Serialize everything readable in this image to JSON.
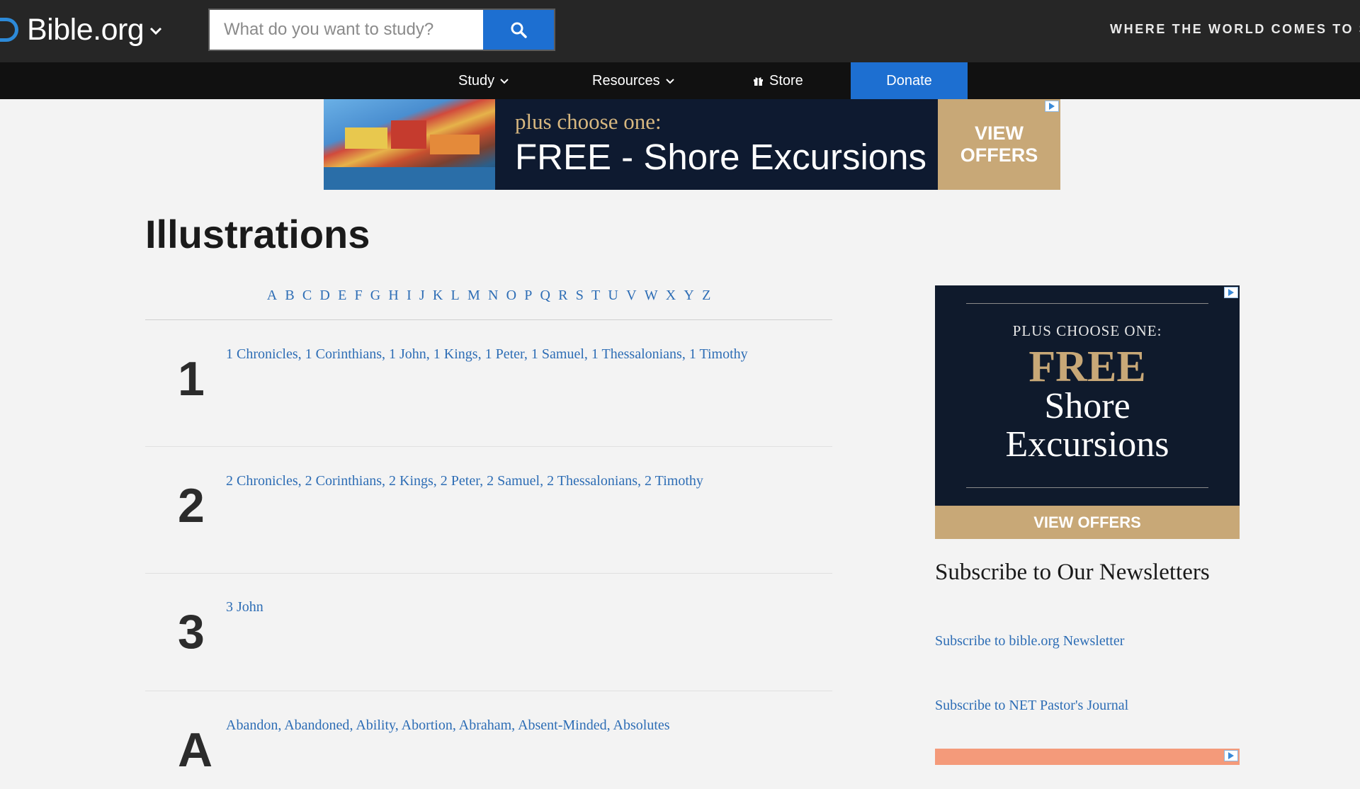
{
  "header": {
    "logo_text": "Bible.org",
    "search_placeholder": "What do you want to study?",
    "tagline": "WHERE THE WORLD COMES TO ST"
  },
  "nav": {
    "items": [
      {
        "label": "Study",
        "has_dropdown": true
      },
      {
        "label": "Resources",
        "has_dropdown": true
      },
      {
        "label": "Store",
        "icon": "gift-icon"
      }
    ],
    "donate_label": "Donate"
  },
  "ad_top": {
    "small": "plus choose one:",
    "big": "FREE - Shore Excursions",
    "cta_line1": "VIEW",
    "cta_line2": "OFFERS"
  },
  "page": {
    "title": "Illustrations",
    "letters": [
      "A",
      "B",
      "C",
      "D",
      "E",
      "F",
      "G",
      "H",
      "I",
      "J",
      "K",
      "L",
      "M",
      "N",
      "O",
      "P",
      "Q",
      "R",
      "S",
      "T",
      "U",
      "V",
      "W",
      "X",
      "Y",
      "Z"
    ],
    "sections": [
      {
        "heading": "1",
        "links": [
          "1 Chronicles",
          "1 Corinthians",
          "1 John",
          "1 Kings",
          "1 Peter",
          "1 Samuel",
          "1 Thessalonians",
          "1 Timothy"
        ]
      },
      {
        "heading": "2",
        "links": [
          "2 Chronicles",
          "2 Corinthians",
          "2 Kings",
          "2 Peter",
          "2 Samuel",
          "2 Thessalonians",
          "2 Timothy"
        ]
      },
      {
        "heading": "3",
        "links": [
          "3 John"
        ]
      },
      {
        "heading": "A",
        "links": [
          "Abandon",
          "Abandoned",
          "Ability",
          "Abortion",
          "Abraham",
          "Absent-Minded",
          "Absolutes"
        ]
      }
    ]
  },
  "sidebar": {
    "ad": {
      "line1": "PLUS CHOOSE ONE:",
      "line2": "FREE",
      "line3": "Shore",
      "line4": "Excursions",
      "cta": "VIEW OFFERS"
    },
    "subscribe_title": "Subscribe to Our Newsletters",
    "subscribe_links": [
      "Subscribe to bible.org Newsletter",
      "Subscribe to NET Pastor's Journal"
    ]
  },
  "colors": {
    "topbar": "#262626",
    "navbar": "#111111",
    "accent_blue": "#1d6fd1",
    "link_blue": "#2d6db5",
    "ad_gold": "#c8a877",
    "ad_navy": "#0e1a30"
  }
}
